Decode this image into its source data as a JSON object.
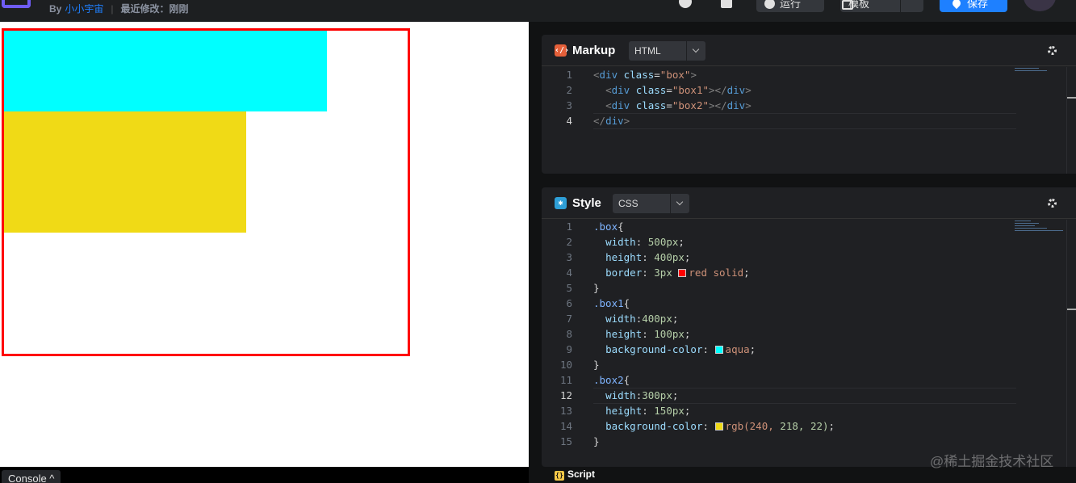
{
  "header": {
    "by_label": "By",
    "author": "小小宇宙",
    "separator": "|",
    "last_modified": "最近修改：刚刚",
    "run_label": "运行",
    "template_label": "模板",
    "save_label": "保存"
  },
  "console": {
    "label": "Console ^"
  },
  "markup": {
    "title": "Markup",
    "language": "HTML",
    "lines": [
      {
        "num": "1",
        "text": "<div class=\"box\">"
      },
      {
        "num": "2",
        "text": "  <div class=\"box1\"></div>"
      },
      {
        "num": "3",
        "text": "  <div class=\"box2\"></div>"
      },
      {
        "num": "4",
        "text": "</div>",
        "active": true
      }
    ]
  },
  "style": {
    "title": "Style",
    "language": "CSS",
    "lines": [
      {
        "num": "1",
        "text": ".box{"
      },
      {
        "num": "2",
        "text": "  width: 500px;"
      },
      {
        "num": "3",
        "text": "  height: 400px;"
      },
      {
        "num": "4",
        "text": "  border: 3px red solid;",
        "swatch": "#ff0000"
      },
      {
        "num": "5",
        "text": "}"
      },
      {
        "num": "6",
        "text": ".box1{"
      },
      {
        "num": "7",
        "text": "  width:400px;"
      },
      {
        "num": "8",
        "text": "  height: 100px;"
      },
      {
        "num": "9",
        "text": "  background-color: aqua;",
        "swatch": "#00ffff"
      },
      {
        "num": "10",
        "text": "}"
      },
      {
        "num": "11",
        "text": ".box2{"
      },
      {
        "num": "12",
        "text": "  width:300px;",
        "active": true
      },
      {
        "num": "13",
        "text": "  height: 150px;"
      },
      {
        "num": "14",
        "text": "  background-color: rgb(240, 218, 22);",
        "swatch": "#f0da16"
      },
      {
        "num": "15",
        "text": "}"
      }
    ]
  },
  "script_tab": {
    "title": "Script"
  },
  "watermark": "@稀土掘金技术社区",
  "colors": {
    "accent": "#1e80ff",
    "box_border": "#ff0000",
    "box1_bg": "#00ffff",
    "box2_bg": "#f0da16"
  }
}
